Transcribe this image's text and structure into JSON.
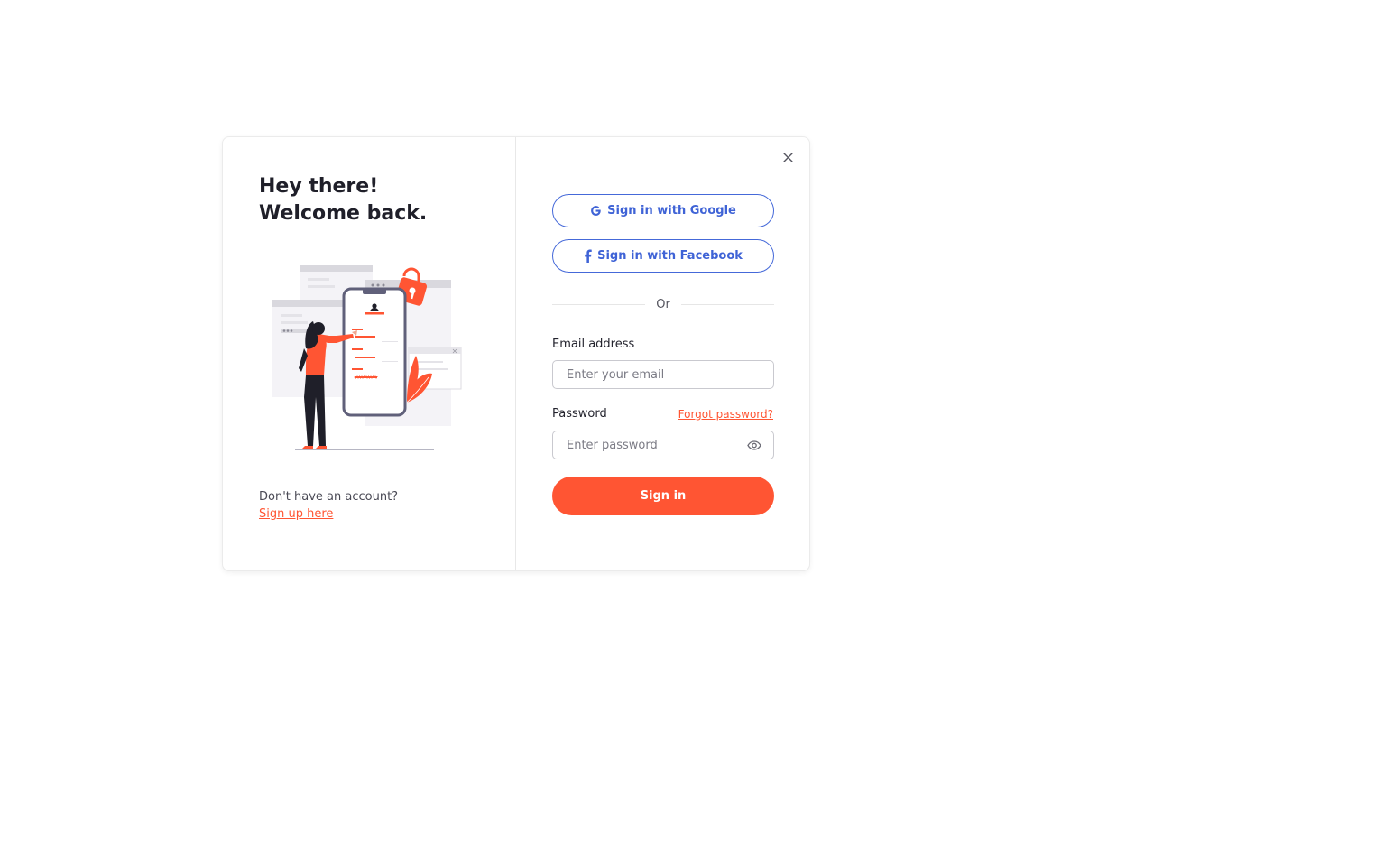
{
  "greeting": {
    "line1": "Hey there!",
    "line2": "Welcome back."
  },
  "signup": {
    "prompt": "Don't have an account?",
    "link": "Sign up here"
  },
  "social": {
    "google_label": "Sign in with Google",
    "facebook_label": "Sign in with Facebook"
  },
  "divider_text": "Or",
  "form": {
    "email_label": "Email address",
    "email_placeholder": "Enter your email",
    "email_value": "",
    "password_label": "Password",
    "password_placeholder": "Enter password",
    "password_value": "",
    "forgot_link": "Forgot password?",
    "submit_label": "Sign in"
  },
  "icons": {
    "close": "close-icon",
    "google": "google-icon",
    "facebook": "facebook-icon",
    "eye": "eye-icon"
  },
  "colors": {
    "accent": "#ff5533",
    "social_blue": "#3f63d6",
    "heading": "#1f1f29",
    "border": "#c9c9cf"
  }
}
